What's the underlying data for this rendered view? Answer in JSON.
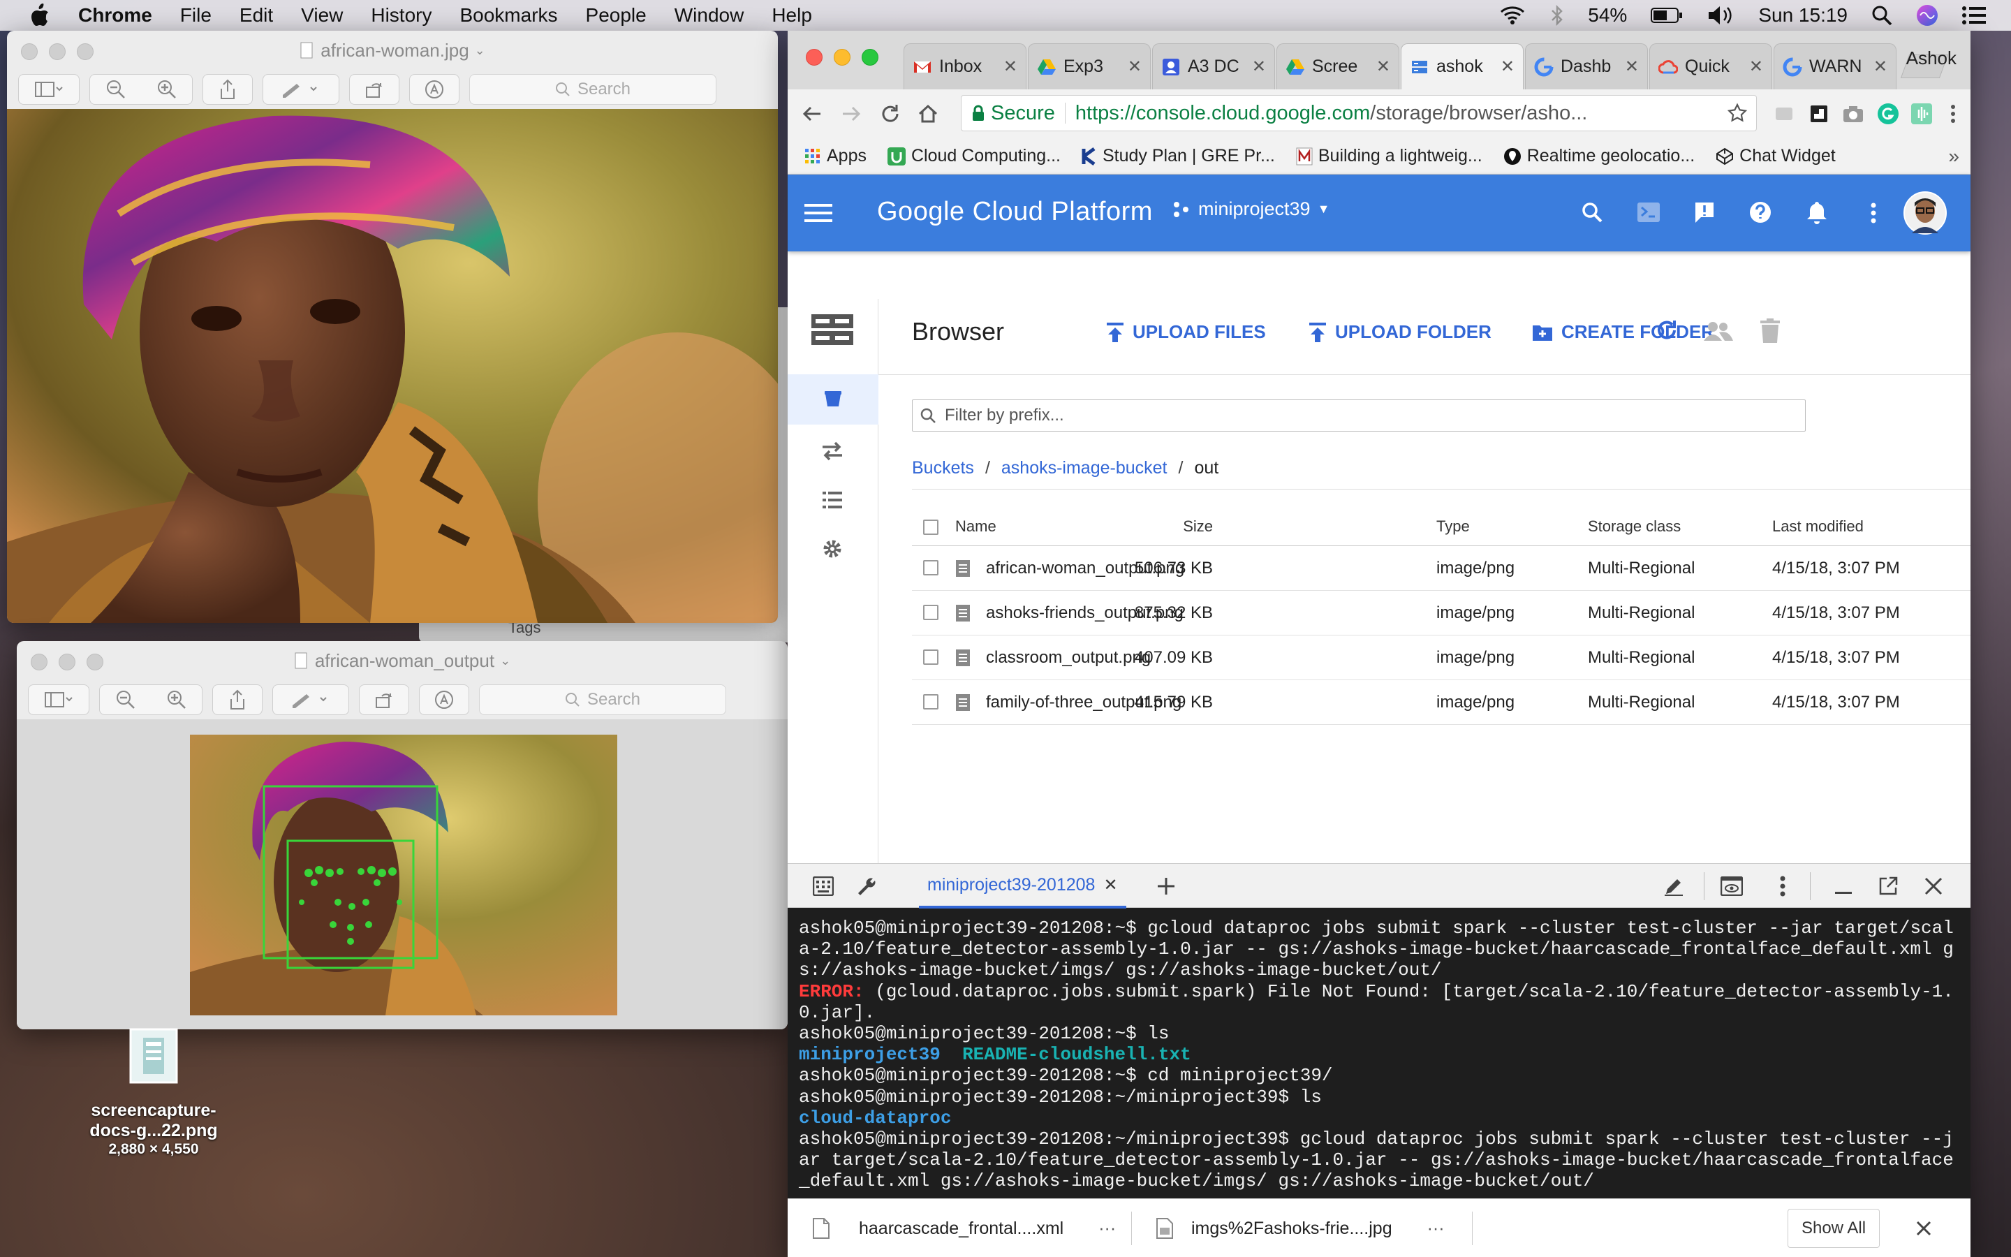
{
  "menubar": {
    "app": "Chrome",
    "items": [
      "File",
      "Edit",
      "View",
      "History",
      "Bookmarks",
      "People",
      "Window",
      "Help"
    ],
    "battery": "54%",
    "clock": "Sun 15:19"
  },
  "preview1": {
    "title": "african-woman.jpg",
    "search_placeholder": "Search",
    "behind_label": "Tags"
  },
  "preview2": {
    "title": "african-woman_output",
    "search_placeholder": "Search"
  },
  "chrome": {
    "profile": "Ashok",
    "tabs": [
      {
        "label": "Inbox",
        "icon": "gmail-icon"
      },
      {
        "label": "Exp3",
        "icon": "drive-icon"
      },
      {
        "label": "A3 DC",
        "icon": "contact-icon"
      },
      {
        "label": "Scree",
        "icon": "drive-icon"
      },
      {
        "label": "ashok",
        "icon": "storage-icon"
      },
      {
        "label": "Dashb",
        "icon": "google-icon"
      },
      {
        "label": "Quick",
        "icon": "cloud-icon"
      },
      {
        "label": "WARN",
        "icon": "google-icon"
      }
    ],
    "secure_label": "Secure",
    "url_host": "https://console.cloud.google.com",
    "url_path": "/storage/browser/asho...",
    "bookmarks": [
      "Apps",
      "Cloud Computing...",
      "Study Plan | GRE Pr...",
      "Building a lightweig...",
      "Realtime geolocatio...",
      "Chat Widget"
    ],
    "bookmarks_more": "»"
  },
  "gcp": {
    "brand": "Google Cloud Platform",
    "project": "miniproject39",
    "page_title": "Browser",
    "upload_files": "UPLOAD FILES",
    "upload_folder": "UPLOAD FOLDER",
    "create_folder": "CREATE FOLDER",
    "filter_placeholder": "Filter by prefix...",
    "breadcrumb": {
      "root": "Buckets",
      "sep1": "/",
      "bucket": "ashoks-image-bucket",
      "sep2": "/",
      "folder": "out"
    },
    "columns": {
      "name": "Name",
      "size": "Size",
      "type": "Type",
      "storage": "Storage class",
      "modified": "Last modified"
    },
    "rows": [
      {
        "name": "african-woman_output.png",
        "size": "506.73 KB",
        "type": "image/png",
        "storage": "Multi-Regional",
        "modified": "4/15/18, 3:07 PM"
      },
      {
        "name": "ashoks-friends_output.png",
        "size": "875.32 KB",
        "type": "image/png",
        "storage": "Multi-Regional",
        "modified": "4/15/18, 3:07 PM"
      },
      {
        "name": "classroom_output.png",
        "size": "407.09 KB",
        "type": "image/png",
        "storage": "Multi-Regional",
        "modified": "4/15/18, 3:07 PM"
      },
      {
        "name": "family-of-three_output.png",
        "size": "415.79 KB",
        "type": "image/png",
        "storage": "Multi-Regional",
        "modified": "4/15/18, 3:07 PM"
      }
    ]
  },
  "shell": {
    "tab_label": "miniproject39-201208",
    "lines": [
      {
        "text": "ashok05@miniproject39-201208:~$ gcloud dataproc jobs submit spark --cluster test-cluster --jar target/scal"
      },
      {
        "text": "a-2.10/feature_detector-assembly-1.0.jar -- gs://ashoks-image-bucket/haarcascade_frontalface_default.xml g"
      },
      {
        "text": "s://ashoks-image-bucket/imgs/ gs://ashoks-image-bucket/out/"
      },
      {
        "prefix": "ERROR:",
        "text": " (gcloud.dataproc.jobs.submit.spark) File Not Found: [target/scala-2.10/feature_detector-assembly-1."
      },
      {
        "text": "0.jar]."
      },
      {
        "text": "ashok05@miniproject39-201208:~$ ls"
      },
      {
        "dir": "miniproject39",
        "gap": "  ",
        "file": "README-cloudshell.txt"
      },
      {
        "text": "ashok05@miniproject39-201208:~$ cd miniproject39/"
      },
      {
        "text": "ashok05@miniproject39-201208:~/miniproject39$ ls"
      },
      {
        "dir": "cloud-dataproc"
      },
      {
        "text": "ashok05@miniproject39-201208:~/miniproject39$ gcloud dataproc jobs submit spark --cluster test-cluster --j"
      },
      {
        "text": "ar target/scala-2.10/feature_detector-assembly-1.0.jar -- gs://ashoks-image-bucket/haarcascade_frontalface"
      },
      {
        "text": "_default.xml gs://ashoks-image-bucket/imgs/ gs://ashoks-image-bucket/out/"
      }
    ]
  },
  "downloads": {
    "items": [
      "haarcascade_frontal....xml",
      "imgs%2Fashoks-frie....jpg"
    ],
    "more": "···",
    "show_all": "Show All"
  },
  "desktop": {
    "file_name_line1": "screencapture-",
    "file_name_line2": "docs-g...22.png",
    "file_dims": "2,880 × 4,550"
  },
  "colors": {
    "gcp_blue": "#3b7ddd",
    "link_blue": "#3367d6",
    "terminal_bg": "#1e1e1e",
    "error_red": "#ff3b3b",
    "face_box": "#39d53a"
  }
}
